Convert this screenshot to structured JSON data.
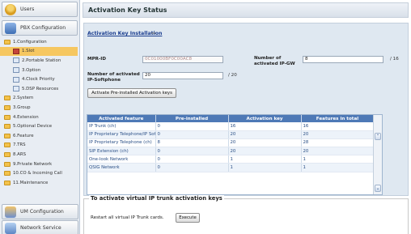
{
  "sidebar": {
    "users": "Users",
    "pbx": "PBX Configuration",
    "tree": [
      {
        "label": "1.Configuration",
        "level": 0
      },
      {
        "label": "1.Slot",
        "level": 1,
        "selected": true
      },
      {
        "label": "2.Portable Station",
        "level": 1
      },
      {
        "label": "3.Option",
        "level": 1
      },
      {
        "label": "4.Clock Priority",
        "level": 1
      },
      {
        "label": "5.DSP Resources",
        "level": 1
      },
      {
        "label": "2.System",
        "level": 0
      },
      {
        "label": "3.Group",
        "level": 0
      },
      {
        "label": "4.Extension",
        "level": 0
      },
      {
        "label": "5.Optional Device",
        "level": 0
      },
      {
        "label": "6.Feature",
        "level": 0
      },
      {
        "label": "7.TRS",
        "level": 0
      },
      {
        "label": "8.ARS",
        "level": 0
      },
      {
        "label": "9.Private Network",
        "level": 0
      },
      {
        "label": "10.CO & Incoming Call",
        "level": 0
      },
      {
        "label": "11.Maintenance",
        "level": 0
      }
    ],
    "um": "UM Configuration",
    "net": "Network Service"
  },
  "main": {
    "title": "Activation Key Status",
    "installation_link": "Activation Key Installation",
    "mpr_label": "MPR-ID",
    "mpr_value": "0C01000BF0C00AC8",
    "ipgw_label": "Number of activated IP-GW",
    "ipgw_value": "8",
    "ipgw_max": "/ 16",
    "softphone_label": "Number of activated IP-Softphone",
    "softphone_value": "20",
    "softphone_max": "/ 20",
    "preinstall_button": "Activate Pre-installed Activation keys"
  },
  "table": {
    "headers": [
      "Activated feature",
      "Pre-installed",
      "Activation key",
      "Features in total"
    ],
    "rows": [
      [
        "IP Trunk (ch)",
        "0",
        "16",
        "16"
      ],
      [
        "IP Proprietary Telephone/IP Softp",
        "0",
        "20",
        "20"
      ],
      [
        "IP Proprietary Telephone (ch)",
        "8",
        "20",
        "28"
      ],
      [
        "SIP Extension (ch)",
        "0",
        "20",
        "20"
      ],
      [
        "One-look Network",
        "0",
        "1",
        "1"
      ],
      [
        "QSIG Network",
        "0",
        "1",
        "1"
      ]
    ]
  },
  "virtual": {
    "legend": "To activate virtual IP trunk activation keys",
    "restart_text": "Restart all virtual IP Trunk cards.",
    "execute_button": "Execute"
  }
}
